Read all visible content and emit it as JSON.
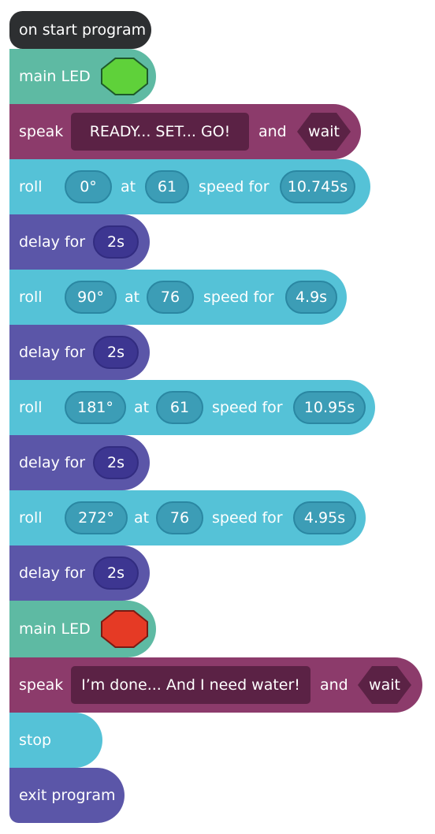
{
  "program": {
    "start_label": "on start program",
    "led1": {
      "label": "main LED",
      "color": "#5fd13a"
    },
    "speak1": {
      "label": "speak",
      "text": "READY... SET... GO!",
      "and": "and",
      "wait": "wait"
    },
    "roll1": {
      "label": "roll",
      "heading": "0°",
      "at": "at",
      "speed": "61",
      "speed_for": "speed for",
      "duration": "10.745s"
    },
    "delay1": {
      "label": "delay for",
      "value": "2s"
    },
    "roll2": {
      "label": "roll",
      "heading": "90°",
      "at": "at",
      "speed": "76",
      "speed_for": "speed for",
      "duration": "4.9s"
    },
    "delay2": {
      "label": "delay for",
      "value": "2s"
    },
    "roll3": {
      "label": "roll",
      "heading": "181°",
      "at": "at",
      "speed": "61",
      "speed_for": "speed for",
      "duration": "10.95s"
    },
    "delay3": {
      "label": "delay for",
      "value": "2s"
    },
    "roll4": {
      "label": "roll",
      "heading": "272°",
      "at": "at",
      "speed": "76",
      "speed_for": "speed for",
      "duration": "4.95s"
    },
    "delay4": {
      "label": "delay for",
      "value": "2s"
    },
    "led2": {
      "label": "main LED",
      "color": "#e53a25"
    },
    "speak2": {
      "label": "speak",
      "text": "I’m done... And I need water!",
      "and": "and",
      "wait": "wait"
    },
    "stop_label": "stop",
    "exit_label": "exit program"
  },
  "colors": {
    "start": "#2d2f31",
    "led": "#5ebaa3",
    "speak": "#8c3b6b",
    "roll": "#55c2d7",
    "delay": "#5b56a8"
  }
}
